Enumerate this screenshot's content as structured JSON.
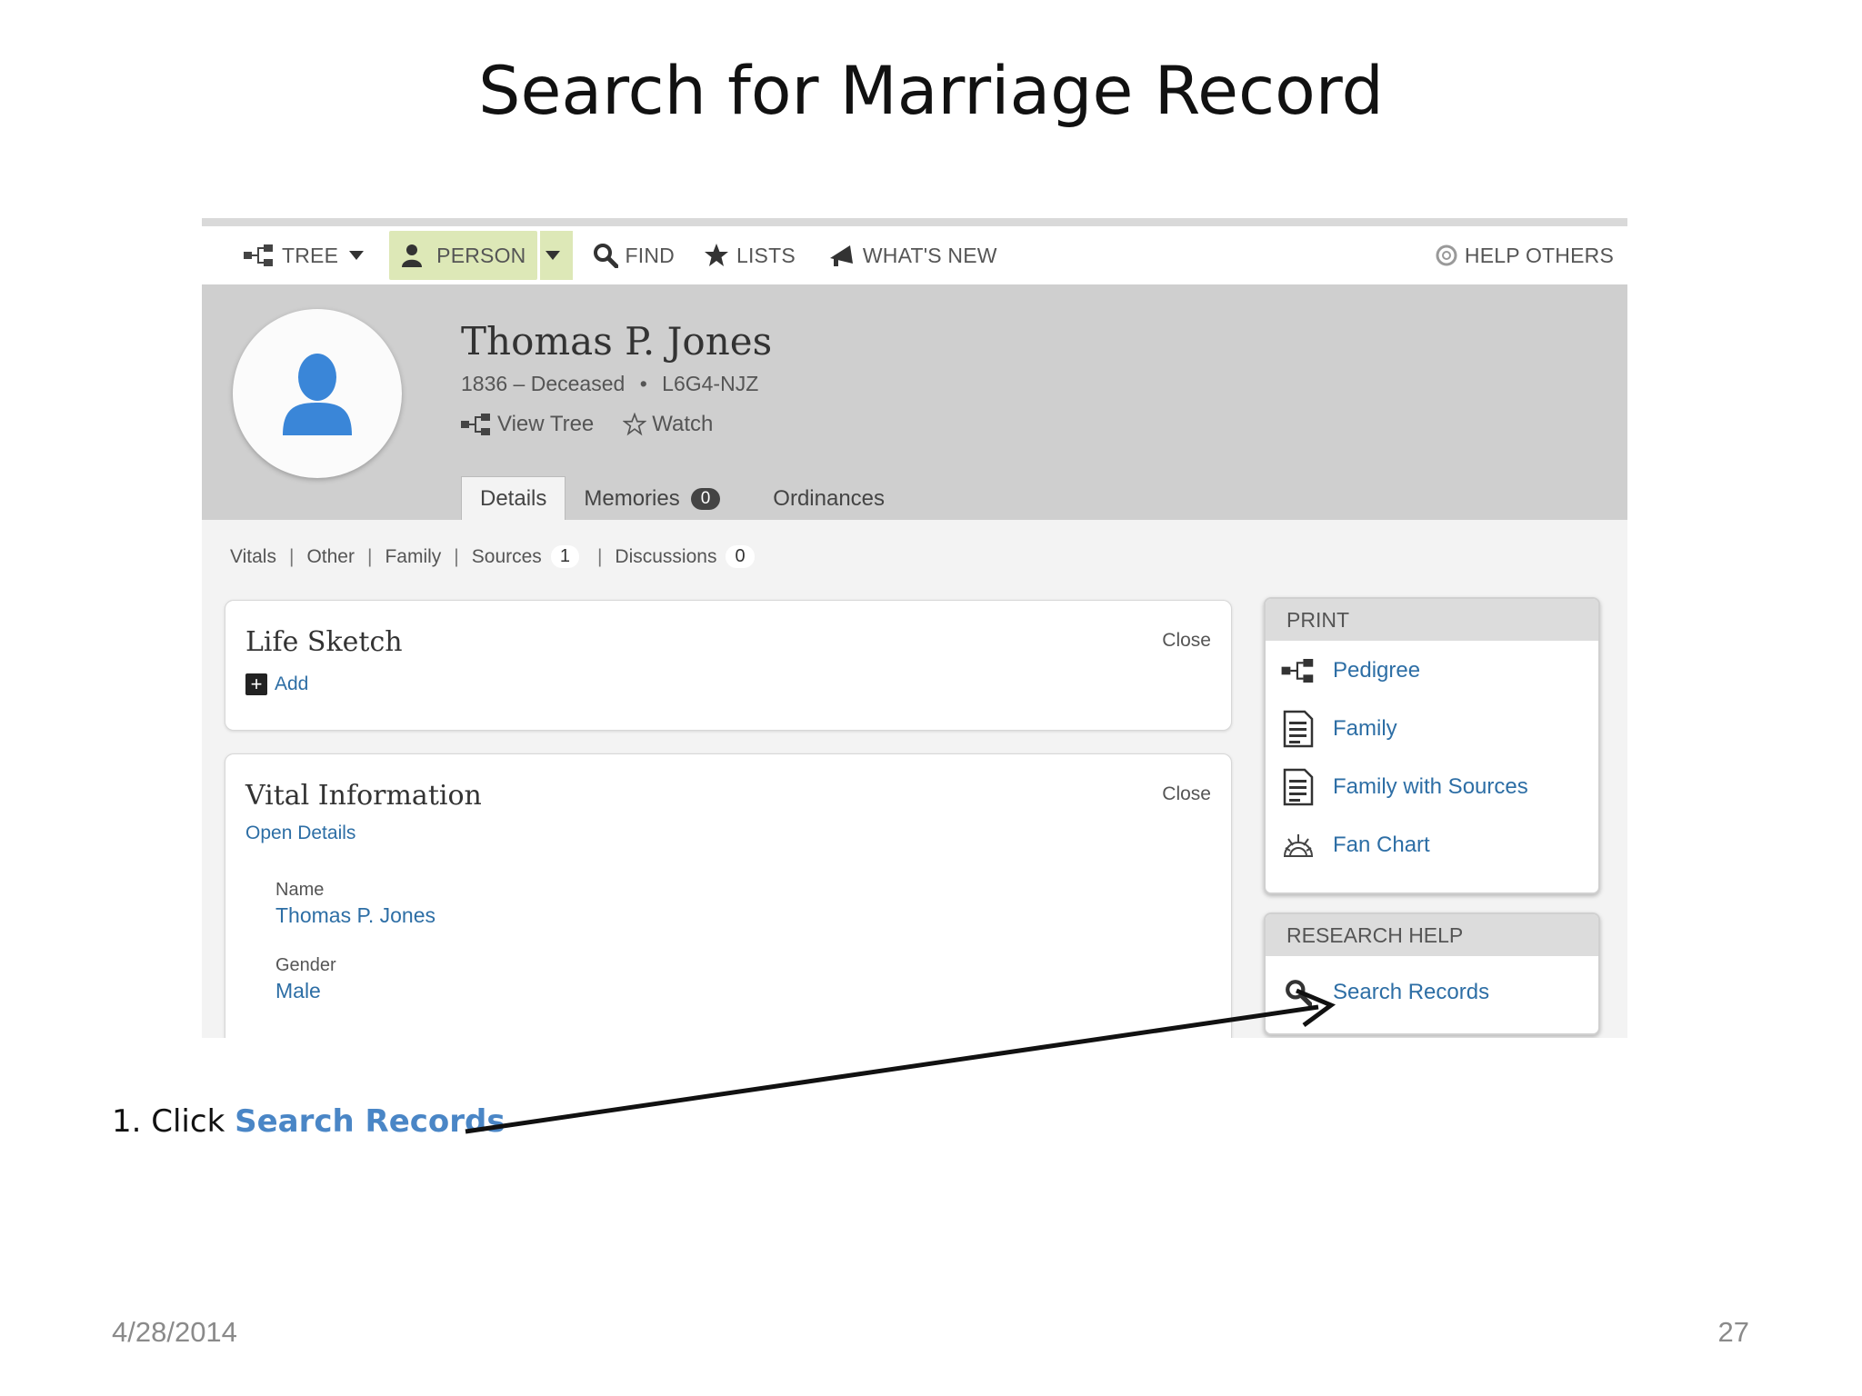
{
  "slide": {
    "title": "Search for Marriage Record",
    "instruction_prefix": "1. Click ",
    "instruction_link": "Search Records",
    "date": "4/28/2014",
    "page_number": "27"
  },
  "nav": {
    "tree": "TREE",
    "person": "PERSON",
    "find": "FIND",
    "lists": "LISTS",
    "whats_new": "WHAT'S NEW",
    "help_others": "HELP OTHERS"
  },
  "person": {
    "name": "Thomas P. Jones",
    "lifespan": "1836 – Deceased",
    "separator": "•",
    "pid": "L6G4-NJZ",
    "view_tree": "View Tree",
    "watch": "Watch"
  },
  "tabs": {
    "details": "Details",
    "memories": "Memories",
    "memories_count": "0",
    "ordinances": "Ordinances"
  },
  "subnav": {
    "vitals": "Vitals",
    "other": "Other",
    "family": "Family",
    "sources": "Sources",
    "sources_count": "1",
    "discussions": "Discussions",
    "discussions_count": "0",
    "separator": "|"
  },
  "life_sketch": {
    "title": "Life Sketch",
    "close": "Close",
    "add": "Add"
  },
  "vital_info": {
    "title": "Vital Information",
    "close": "Close",
    "open_details": "Open Details",
    "name_label": "Name",
    "name_value": "Thomas P. Jones",
    "gender_label": "Gender",
    "gender_value": "Male"
  },
  "print": {
    "header": "PRINT",
    "items": [
      "Pedigree",
      "Family",
      "Family with Sources",
      "Fan Chart"
    ]
  },
  "research_help": {
    "header": "RESEARCH HELP",
    "search_records": "Search Records"
  },
  "colors": {
    "accent_blue": "#2d6ea5",
    "person_highlight": "#dde8b7",
    "header_band": "#cfcfcf",
    "avatar_blue": "#3a86d8",
    "instruction_highlight": "#4a86c6"
  }
}
